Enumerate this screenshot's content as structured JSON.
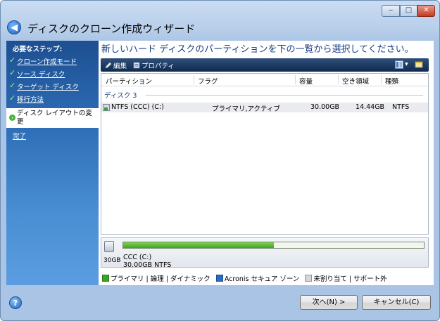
{
  "window": {
    "title": "ディスクのクローン作成ウィザード",
    "controls": {
      "minimize": "‒",
      "maximize": "□",
      "close": "✕"
    },
    "back_icon": "◀"
  },
  "sidebar": {
    "heading": "必要なステップ:",
    "check_mark": "✓",
    "steps": [
      {
        "label": "クローン作成モード"
      },
      {
        "label": "ソース ディスク"
      },
      {
        "label": "ターゲット ディスク"
      },
      {
        "label": "移行方法"
      }
    ],
    "current": {
      "label": "ディスク レイアウトの変更"
    },
    "remaining": [
      {
        "label": "完了"
      }
    ]
  },
  "main": {
    "prompt": "新しいハード ディスクのパーティションを下の一覧から選択してください。",
    "toolbar": {
      "edit": "編集",
      "properties": "プロパティ"
    },
    "table": {
      "columns": [
        "パーティション",
        "フラグ",
        "容量",
        "空き領域",
        "種類"
      ],
      "group": "ディスク 3",
      "rows": [
        {
          "partition": "NTFS (CCC) (C:)",
          "flags": "プライマリ,アクティブ",
          "capacity": "30.00GB",
          "free": "14.44GB",
          "type": "NTFS"
        }
      ]
    },
    "disk": {
      "size": "30GB",
      "partition_name": "CCC (C:)",
      "partition_detail": "30.00GB  NTFS",
      "used_fraction": 0.5
    },
    "legend": {
      "primary": "プライマリ | 論理 | ダイナミック",
      "acronis": "Acronis セキュア ゾーン",
      "unallocated": "未割り当て | サポート外"
    }
  },
  "footer": {
    "help": "?",
    "next": "次へ(N) >",
    "cancel": "キャンセル(C)"
  },
  "colors": {
    "accent": "#1c3f86",
    "sidebar": "#2c6bb4",
    "primary_partition": "#3ea324",
    "acronis_zone": "#2d6ac2",
    "unallocated": "#d4d6da"
  }
}
